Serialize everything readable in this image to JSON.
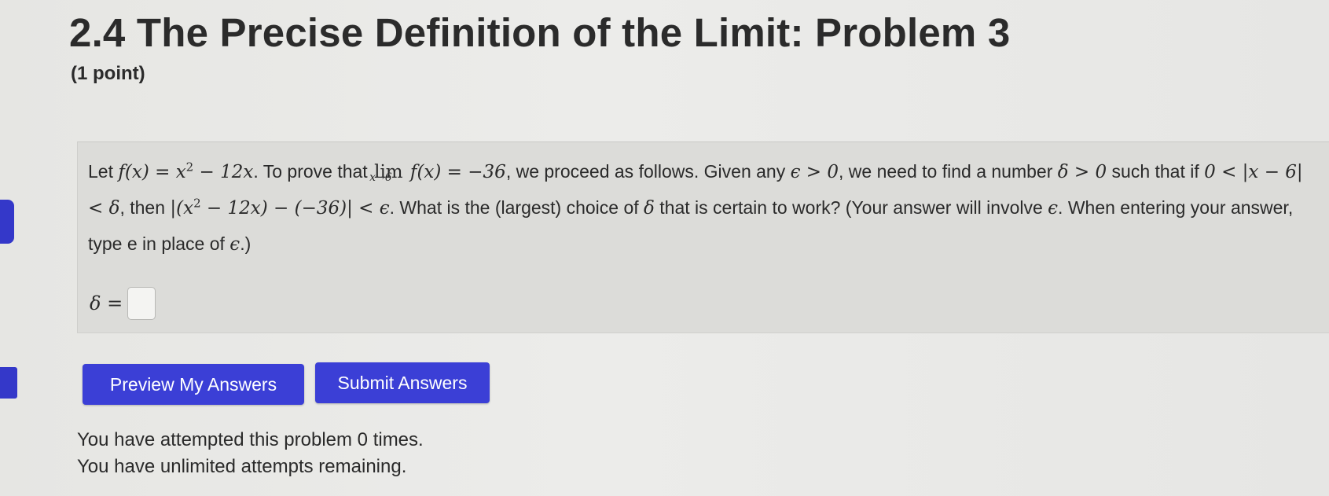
{
  "page": {
    "title": "2.4 The Precise Definition of the Limit: Problem 3",
    "points": "(1 point)"
  },
  "problem": {
    "t1": "Let ",
    "m1": "f(x) = x",
    "m1sup": "2",
    "m1b": " − 12x",
    "t2": ". To prove that ",
    "lim_word": "lim",
    "lim_sub": "x→6",
    "m2": " f(x) = −36",
    "t3": ", we proceed as follows. Given any ",
    "m3": "ϵ > 0",
    "t4": ", we need to find a number ",
    "m4": "δ > 0",
    "t5": " such that if ",
    "m5": "0 < |x − 6| < δ",
    "t6": ", then ",
    "m6a": "|(x",
    "m6sup": "2",
    "m6b": " − 12x) − (−36)| < ϵ",
    "t7": ". What is the (largest) choice of ",
    "m7": "δ",
    "t8": " that is certain to work? (Your answer will involve ",
    "m8": "ϵ",
    "t9": ". When entering your answer, type e in place of ",
    "m9": "ϵ",
    "t10": ".)"
  },
  "answer": {
    "label": "δ =",
    "value": ""
  },
  "buttons": {
    "preview": "Preview My Answers",
    "submit": "Submit Answers"
  },
  "status": {
    "attempts": "You have attempted this problem 0 times.",
    "remaining": "You have unlimited attempts remaining."
  },
  "colors": {
    "button": "#3b3fd6",
    "background": "#e9e9e7",
    "problem_box": "#dcdcd9"
  }
}
